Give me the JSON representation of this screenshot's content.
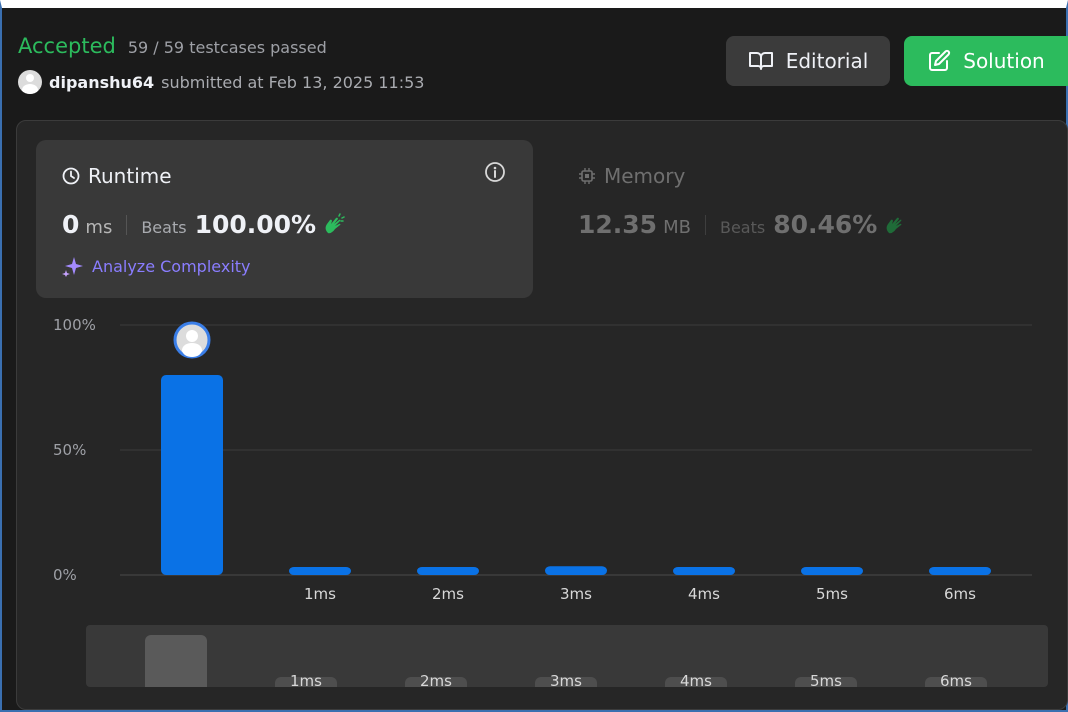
{
  "header": {
    "status": "Accepted",
    "testcases": "59 / 59 testcases passed",
    "username": "dipanshu64",
    "submitted_text": "submitted at Feb 13, 2025 11:53",
    "editorial_label": "Editorial",
    "solution_label": "Solution"
  },
  "runtime": {
    "title": "Runtime",
    "value": "0",
    "unit": "ms",
    "beats_label": "Beats",
    "beats_value": "100.00%",
    "analyze_label": "Analyze Complexity"
  },
  "memory": {
    "title": "Memory",
    "value": "12.35",
    "unit": "MB",
    "beats_label": "Beats",
    "beats_value": "80.46%"
  },
  "colors": {
    "accent_green": "#2cbb5d",
    "bar_blue": "#0a72e6",
    "analyze_purple": "#8a7dff"
  },
  "chart_data": {
    "type": "bar",
    "categories": [
      "",
      "1ms",
      "2ms",
      "3ms",
      "4ms",
      "5ms",
      "6ms"
    ],
    "values": [
      80,
      3,
      3,
      3.5,
      3,
      3,
      3
    ],
    "ytick_labels": [
      "100%",
      "50%",
      "0%"
    ],
    "ylim": [
      0,
      100
    ],
    "highlighted_index": 0,
    "grid": true
  },
  "scrubber": {
    "labels": [
      "1ms",
      "2ms",
      "3ms",
      "4ms",
      "5ms",
      "6ms"
    ]
  }
}
